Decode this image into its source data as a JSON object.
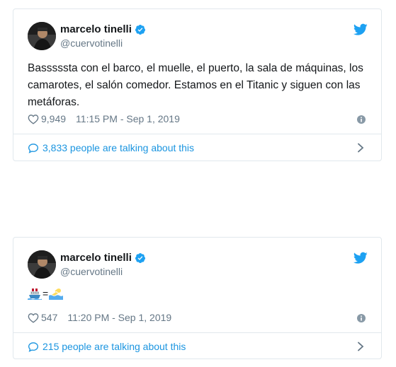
{
  "tweets": [
    {
      "name": "marcelo tinelli",
      "handle": "@cuervotinelli",
      "text": "Basssssta con el barco, el muelle, el puerto, la sala de máquinas, los camarotes, el salón comedor. Estamos en el Titanic y siguen con las metáforas.",
      "likes": "9,949",
      "timestamp": "11:15 PM - Sep 1, 2019",
      "talking": "3,833 people are talking about this"
    },
    {
      "name": "marcelo tinelli",
      "handle": "@cuervotinelli",
      "emoji_text": [
        "ship-emoji",
        "=",
        "swimmer-emoji"
      ],
      "equals": "=",
      "likes": "547",
      "timestamp": "11:20 PM - Sep 1, 2019",
      "talking": "215 people are talking about this"
    }
  ],
  "colors": {
    "link": "#1b95e0",
    "twitter_blue": "#1da1f2",
    "muted": "#657786",
    "border": "#e1e8ed"
  },
  "icons": [
    "avatar",
    "verified-badge-icon",
    "twitter-bird-icon",
    "heart-icon",
    "info-icon",
    "speech-bubble-icon",
    "chevron-right-icon"
  ]
}
